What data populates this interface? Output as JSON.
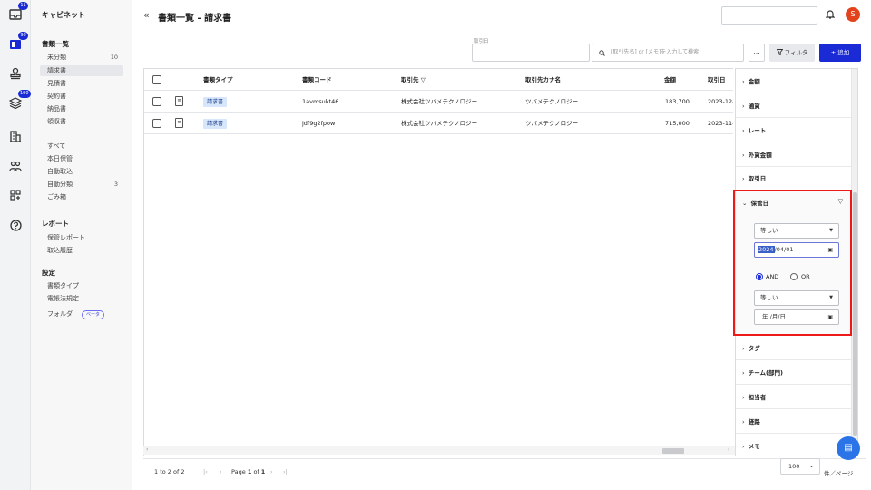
{
  "app": {
    "brand": "キャビネット",
    "page_title": "書類一覧 - 請求書",
    "avatar_initial": "S"
  },
  "rail": {
    "badges": [
      "11",
      "98",
      "100"
    ]
  },
  "sidebar": {
    "section1": "書類一覧",
    "items1": [
      {
        "label": "未分類",
        "count": "10"
      },
      {
        "label": "請求書",
        "count": ""
      },
      {
        "label": "見積書",
        "count": ""
      },
      {
        "label": "契約書",
        "count": ""
      },
      {
        "label": "納品書",
        "count": ""
      },
      {
        "label": "領収書",
        "count": ""
      }
    ],
    "items2": [
      {
        "label": "すべて",
        "count": ""
      },
      {
        "label": "本日保管",
        "count": ""
      },
      {
        "label": "自動取込",
        "count": ""
      },
      {
        "label": "自動分類",
        "count": "3"
      },
      {
        "label": "ごみ箱",
        "count": ""
      }
    ],
    "section2": "レポート",
    "items3": [
      {
        "label": "保管レポート"
      },
      {
        "label": "取込履歴"
      }
    ],
    "section3": "設定",
    "items4": [
      {
        "label": "書類タイプ"
      },
      {
        "label": "電帳法規定"
      },
      {
        "label": "フォルダ",
        "badge": "ベータ"
      }
    ]
  },
  "toolbar": {
    "torihikisaki_label": "取引日",
    "search_placeholder": "[取引先名] or [メモ]を入力して検索",
    "more_label": "...",
    "filter_label": "フィルタ",
    "add_label": "+ 追加"
  },
  "table": {
    "columns": [
      "書類タイプ",
      "書類コード",
      "取引先",
      "取引先カナ名",
      "金額",
      "取引日"
    ],
    "rows": [
      {
        "type": "請求書",
        "code": "1avmsukt46",
        "partner": "株式会社ツバメテクノロジー",
        "kana": "ツバメテクノロジー",
        "amount": "183,700",
        "date": "2023-12-"
      },
      {
        "type": "請求書",
        "code": "jdf9g2fpow",
        "partner": "株式会社ツバメテクノロジー",
        "kana": "ツバメテクノロジー",
        "amount": "715,000",
        "date": "2023-11-"
      }
    ]
  },
  "pager": {
    "count_text": "1 to 2 of 2",
    "page_label": "Page",
    "page_num": "1",
    "of_label": "of",
    "page_total": "1",
    "per_page": "100",
    "per_page_suffix": "件／ページ"
  },
  "filter_panel": {
    "sections_top": [
      "金額",
      "通貨",
      "レート",
      "外貨金額",
      "取引日"
    ],
    "open_section": "保管日",
    "operator1": "等しい",
    "date1_year": "2024",
    "date1_rest": "/04/01",
    "and_label": "AND",
    "or_label": "OR",
    "operator2": "等しい",
    "date2_placeholder": "年 /月/日",
    "sections_bottom": [
      "タグ",
      "チーム(部門)",
      "担当者",
      "経路",
      "メモ"
    ]
  }
}
